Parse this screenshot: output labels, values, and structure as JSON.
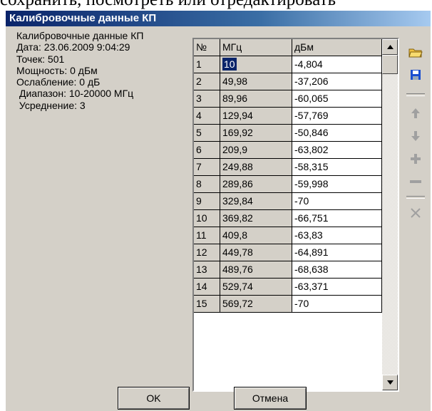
{
  "background_text": "сохранить, посмотреть или отредактировать",
  "dialog": {
    "title": "Калибровочные данные КП"
  },
  "info": {
    "line1": "Калибровочные данные КП",
    "line2": "Дата: 23.06.2009 9:04:29",
    "line3": "Точек: 501",
    "line4": "Мощность: 0 дБм",
    "line5": "Ослабление: 0 дБ",
    "line6": "Диапазон: 10-20000 МГц",
    "line7": " Усреднение: 3"
  },
  "table": {
    "headers": [
      "№",
      "МГц",
      "дБм"
    ],
    "rows": [
      [
        "1",
        "10",
        "-4,804"
      ],
      [
        "2",
        "49,98",
        "-37,206"
      ],
      [
        "3",
        "89,96",
        "-60,065"
      ],
      [
        "4",
        "129,94",
        "-57,769"
      ],
      [
        "5",
        "169,92",
        "-50,846"
      ],
      [
        "6",
        "209,9",
        "-63,802"
      ],
      [
        "7",
        "249,88",
        "-58,315"
      ],
      [
        "8",
        "289,86",
        "-59,998"
      ],
      [
        "9",
        "329,84",
        "-70"
      ],
      [
        "10",
        "369,82",
        "-66,751"
      ],
      [
        "11",
        "409,8",
        "-63,83"
      ],
      [
        "12",
        "449,78",
        "-64,891"
      ],
      [
        "13",
        "489,76",
        "-68,638"
      ],
      [
        "14",
        "529,74",
        "-63,371"
      ],
      [
        "15",
        "569,72",
        "-70"
      ]
    ],
    "selected_row": 0
  },
  "toolbar": {
    "icons": [
      "open-folder-icon",
      "save-icon",
      "arrow-up-icon",
      "arrow-down-icon",
      "plus-icon",
      "minus-icon",
      "delete-icon"
    ],
    "colors": {
      "folder": "#f0c040",
      "save": "#1a4fd0",
      "disabled": "#a0a0a0"
    }
  },
  "buttons": {
    "ok": "OK",
    "cancel": "Отмена"
  }
}
